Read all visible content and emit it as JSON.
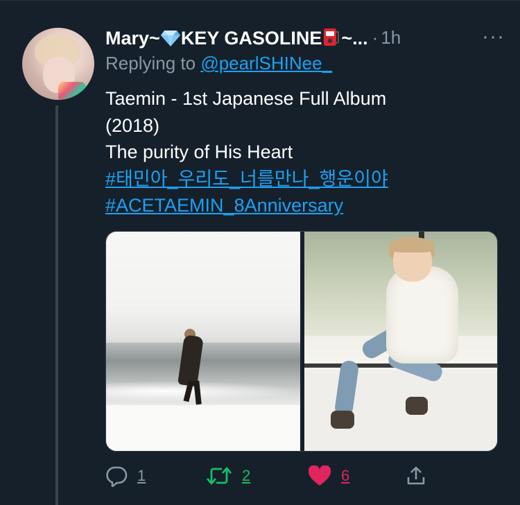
{
  "tweet": {
    "author": {
      "display_name": "Mary~💎KEY GASOLINE⛽~...",
      "name_part1": "Mary~",
      "name_part2": "KEY GASOLINE",
      "name_part3": "~...",
      "emoji1_icon": "gem-icon",
      "emoji2_icon": "fuel-pump-icon"
    },
    "separator": "·",
    "time": "1h",
    "more_label": "···",
    "replying_prefix": "Replying to",
    "replying_handle": "@pearlSHINee_",
    "text_lines": [
      "Taemin - 1st Japanese Full Album",
      "(2018)",
      "The purity of His Heart"
    ],
    "hashtags": [
      "#태민아_우리도_너를만나_행운이야",
      "#ACETAEMIN_8Anniversary"
    ],
    "media": [
      {
        "description_icon": "photo-beach"
      },
      {
        "description_icon": "photo-sweater"
      }
    ],
    "actions": {
      "reply_count": "1",
      "retweet_count": "2",
      "like_count": "6"
    }
  },
  "colors": {
    "background": "#15202b",
    "accent": "#1da1f2",
    "muted": "#8899a6",
    "retweet": "#17bf63",
    "like": "#e0245e"
  }
}
